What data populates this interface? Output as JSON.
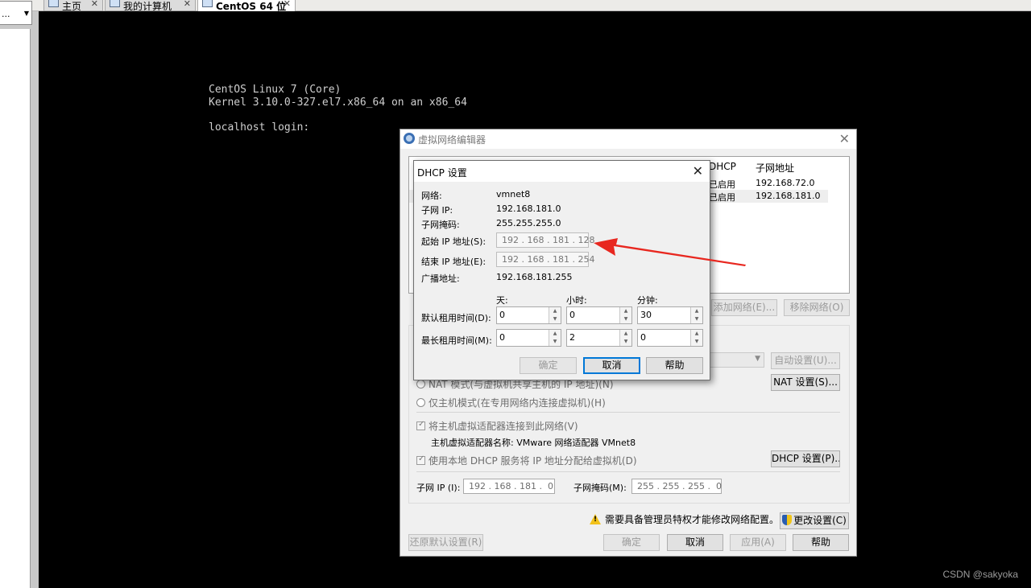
{
  "tabs": [
    {
      "label": "主页"
    },
    {
      "label": "我的计算机"
    },
    {
      "label": "CentOS 64 位"
    }
  ],
  "library": {
    "combo_value": "..."
  },
  "console": {
    "lines": [
      "CentOS Linux 7 (Core)",
      "Kernel 3.10.0-327.el7.x86_64 on an x86_64",
      "",
      "localhost login:"
    ]
  },
  "vne": {
    "title": "虚拟网络编辑器",
    "list": {
      "columns": [
        "DHCP",
        "子网地址"
      ],
      "rows": [
        {
          "dhcp": "已启用",
          "subnet": "192.168.72.0"
        },
        {
          "dhcp": "已启用",
          "subnet": "192.168.181.0"
        }
      ]
    },
    "add_network": "添加网络(E)...",
    "remove_network": "移除网络(O)",
    "auto_settings": "自动设置(U)...",
    "nat_mode": "NAT 模式(与虚拟机共享主机的 IP 地址)(N)",
    "nat_settings": "NAT 设置(S)...",
    "host_only": "仅主机模式(在专用网络内连接虚拟机)(H)",
    "connect_adapter": "将主机虚拟适配器连接到此网络(V)",
    "adapter_name": "主机虚拟适配器名称: VMware 网络适配器 VMnet8",
    "use_dhcp": "使用本地 DHCP 服务将 IP 地址分配给虚拟机(D)",
    "dhcp_settings": "DHCP 设置(P)...",
    "subnet_ip_label": "子网 IP (I):",
    "subnet_ip": "192 . 168 . 181 .  0",
    "subnet_mask_label": "子网掩码(M):",
    "subnet_mask": "255 . 255 . 255 .  0",
    "admin_warning": "需要具备管理员特权才能修改网络配置。",
    "change_settings": "更改设置(C)",
    "restore_defaults": "还原默认设置(R)",
    "ok": "确定",
    "cancel": "取消",
    "apply": "应用(A)",
    "help": "帮助"
  },
  "dhcp": {
    "title": "DHCP 设置",
    "network_label": "网络:",
    "network": "vmnet8",
    "subnet_ip_label": "子网 IP:",
    "subnet_ip": "192.168.181.0",
    "subnet_mask_label": "子网掩码:",
    "subnet_mask": "255.255.255.0",
    "start_ip_label": "起始 IP 地址(S):",
    "start_ip": "192 . 168 . 181 . 128",
    "end_ip_label": "结束 IP 地址(E):",
    "end_ip": "192 . 168 . 181 . 254",
    "broadcast_label": "广播地址:",
    "broadcast": "192.168.181.255",
    "days_label": "天:",
    "hours_label": "小时:",
    "minutes_label": "分钟:",
    "default_lease_label": "默认租用时间(D):",
    "default_lease": {
      "days": "0",
      "hours": "0",
      "minutes": "30"
    },
    "max_lease_label": "最长租用时间(M):",
    "max_lease": {
      "days": "0",
      "hours": "2",
      "minutes": "0"
    },
    "ok": "确定",
    "cancel": "取消",
    "help": "帮助"
  },
  "watermark": "CSDN @sakyoka",
  "colors": {
    "annotation_arrow": "#e8271f",
    "console_text": "#cfcfcf"
  }
}
